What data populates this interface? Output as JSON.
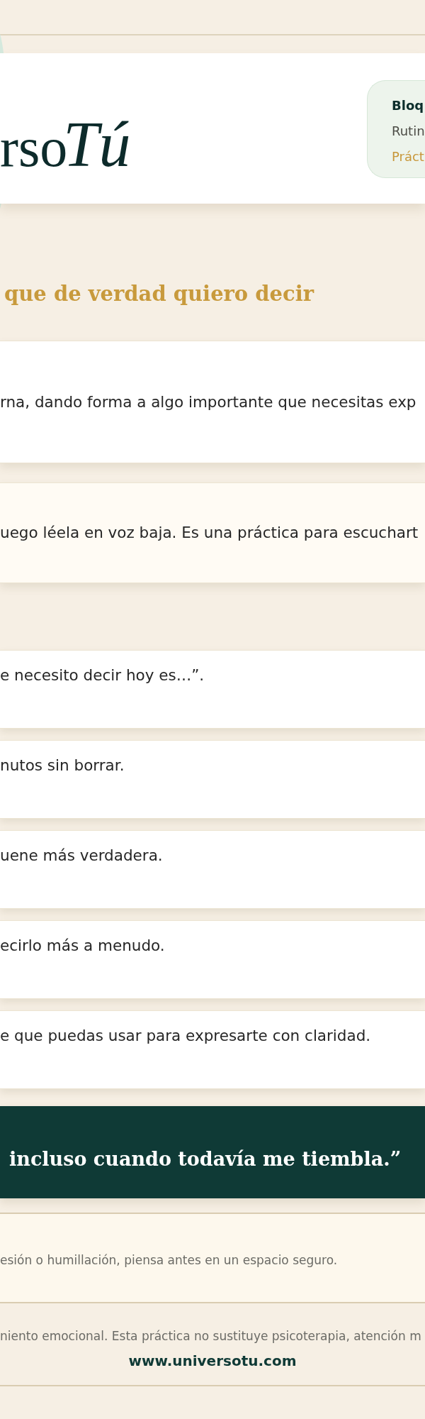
{
  "header": {
    "logo": {
      "serif_text": "rso",
      "script_text": "Tú"
    },
    "info_box": {
      "title": "Bloq",
      "subtitle": "Rutin",
      "tag": "Práct"
    }
  },
  "section_title": "que de verdad quiero decir",
  "intro_card": {
    "text": "rna, dando forma a algo importante que necesitas exp"
  },
  "instruction_card": {
    "text": "uego léela en voz baja. Es una práctica para escuchart"
  },
  "steps": [
    {
      "text": "e necesito decir hoy es…”."
    },
    {
      "text": "nutos sin borrar."
    },
    {
      "text": "uene más verdadera."
    },
    {
      "text": "ecirlo más a menudo."
    },
    {
      "text": "e que puedas usar para expresarte con claridad."
    }
  ],
  "quote": "incluso cuando todavía me tiembla.”",
  "note": "esión o humillación, piensa antes en un espacio seguro.",
  "footer": {
    "disclaimer": "niento emocional. Esta práctica no sustituye psicoterapia, atención m",
    "website": "www.universotu.com"
  }
}
